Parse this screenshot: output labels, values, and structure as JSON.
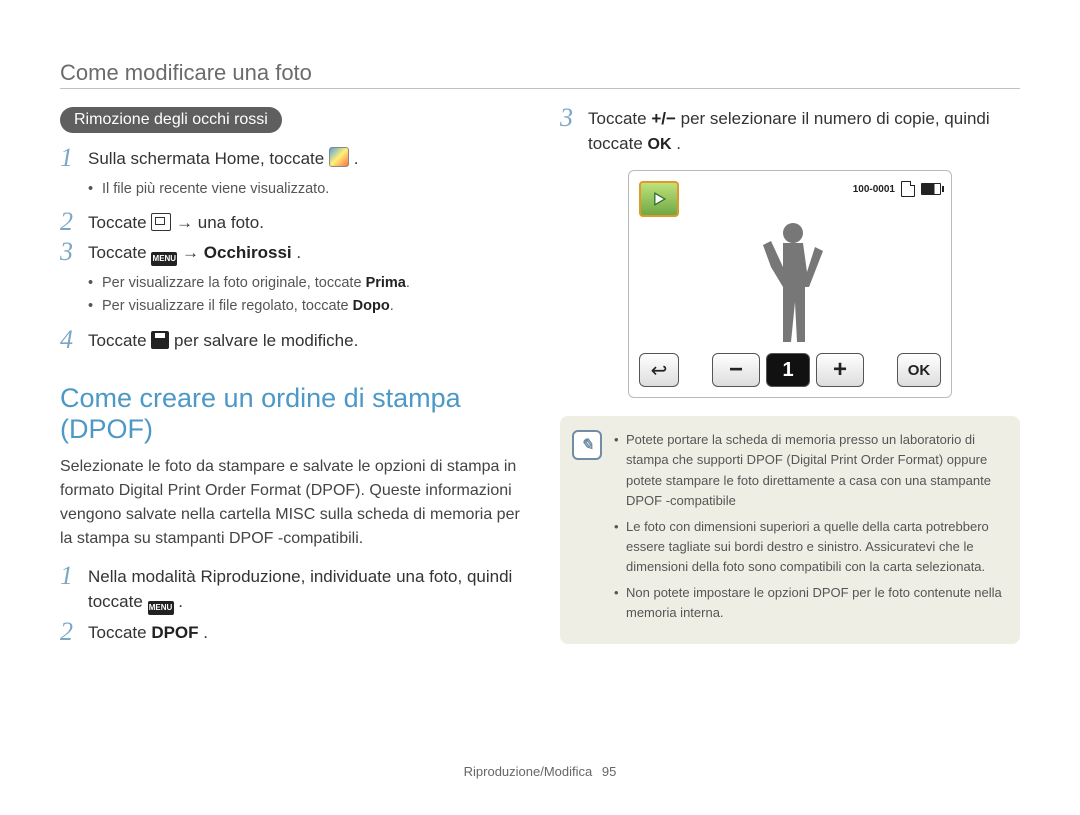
{
  "header": {
    "title": "Come modificare una foto"
  },
  "left": {
    "pill": "Rimozione degli occhi rossi",
    "steps": {
      "s1": {
        "num": "1",
        "text_a": "Sulla schermata Home, toccate ",
        "text_b": "."
      },
      "s1_sub": [
        "Il file più recente viene visualizzato."
      ],
      "s2": {
        "num": "2",
        "text_a": "Toccate ",
        "text_b": " → una foto."
      },
      "s3": {
        "num": "3",
        "text_a": "Toccate ",
        "menu": "MENU",
        "text_b": " → ",
        "bold": "Occhirossi",
        "text_c": "."
      },
      "s3_sub": [
        {
          "a": "Per visualizzare la foto originale, toccate ",
          "bold": "Prima",
          "b": "."
        },
        {
          "a": "Per visualizzare il file regolato, toccate ",
          "bold": "Dopo",
          "b": "."
        }
      ],
      "s4": {
        "num": "4",
        "text_a": "Toccate ",
        "text_b": " per salvare le modifiche."
      }
    },
    "section_heading": "Come creare un ordine di stampa (DPOF)",
    "section_para": "Selezionate le foto da stampare e salvate le opzioni di stampa in formato Digital Print Order Format (DPOF). Queste informazioni vengono salvate nella cartella MISC sulla scheda di memoria per la stampa su stampanti DPOF -compatibili.",
    "dpof_steps": {
      "s1": {
        "num": "1",
        "text_a": "Nella modalità Riproduzione, individuate una foto, quindi toccate ",
        "menu": "MENU",
        "text_b": "."
      },
      "s2": {
        "num": "2",
        "text_a": "Toccate ",
        "bold": "DPOF",
        "text_b": "."
      }
    }
  },
  "right": {
    "step3": {
      "num": "3",
      "text_a": "Toccate ",
      "pm": "+/−",
      "text_b": " per selezionare il numero di copie, quindi toccate ",
      "ok": "OK",
      "text_c": "."
    },
    "screen": {
      "file_number": "100-0001",
      "count": "1",
      "ok": "OK"
    },
    "notes": [
      "Potete portare la scheda di memoria presso un laboratorio di stampa che supporti DPOF (Digital Print Order Format) oppure potete stampare le foto direttamente a casa con una stampante DPOF -compatibile",
      "Le foto con dimensioni superiori a quelle della carta potrebbero essere tagliate sui bordi destro e sinistro. Assicuratevi che le dimensioni della foto sono compatibili con la carta selezionata.",
      "Non potete impostare le opzioni DPOF per le foto contenute nella memoria interna."
    ]
  },
  "footer": {
    "section": "Riproduzione/Modifica",
    "page": "95"
  }
}
